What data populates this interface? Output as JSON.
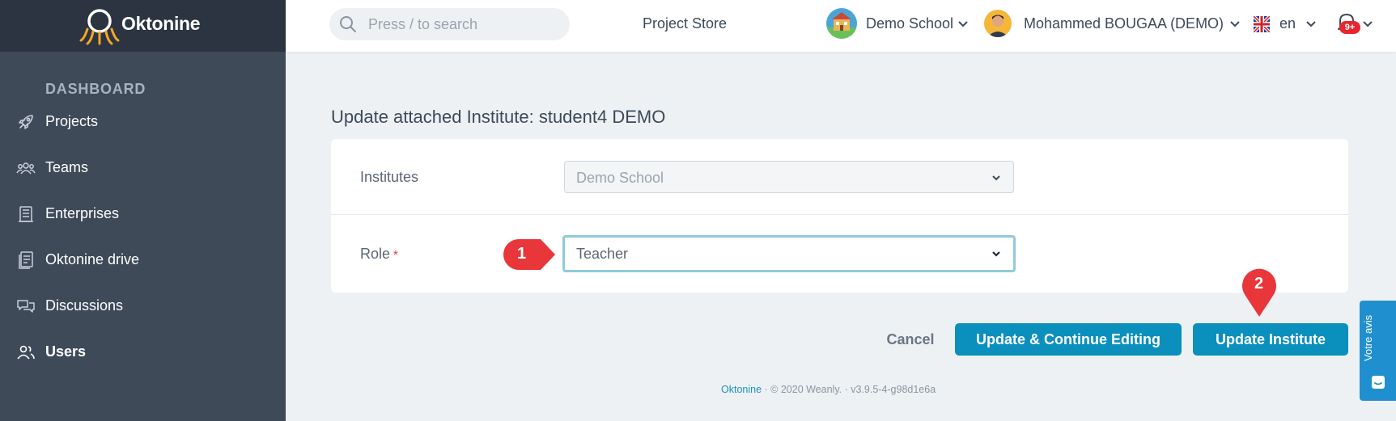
{
  "brand": {
    "name": "Oktonine"
  },
  "sidebar": {
    "section_label": "DASHBOARD",
    "items": [
      {
        "label": "Projects",
        "icon": "rocket-icon"
      },
      {
        "label": "Teams",
        "icon": "team-icon"
      },
      {
        "label": "Enterprises",
        "icon": "building-icon"
      },
      {
        "label": "Oktonine drive",
        "icon": "drive-icon"
      },
      {
        "label": "Discussions",
        "icon": "chat-icon"
      },
      {
        "label": "Users",
        "icon": "users-icon",
        "active": true
      }
    ]
  },
  "topbar": {
    "search_placeholder": "Press / to search",
    "project_store": "Project Store",
    "school": "Demo School",
    "user": "Mohammed BOUGAA (DEMO)",
    "language": "en",
    "notification_badge": "9+"
  },
  "form": {
    "title": "Update attached Institute: student4 DEMO",
    "institutes_label": "Institutes",
    "institutes_value": "Demo School",
    "role_label": "Role",
    "role_required_mark": "*",
    "role_value": "Teacher"
  },
  "actions": {
    "cancel": "Cancel",
    "update_continue": "Update & Continue Editing",
    "update_institute": "Update Institute"
  },
  "footer": {
    "brand": "Oktonine",
    "copyright": "· © 2020 Weanly. · v3.9.5-4-g98d1e6a"
  },
  "feedback": {
    "label": "Votre avis"
  },
  "callouts": {
    "first": "1",
    "second": "2"
  },
  "colors": {
    "primary": "#0b8fbd",
    "sidebar": "#3e4a58",
    "brand_bar": "#2b3440",
    "callout": "#e8363a",
    "focus_ring": "#8fcbdc",
    "feedback": "#1f8fd0"
  }
}
